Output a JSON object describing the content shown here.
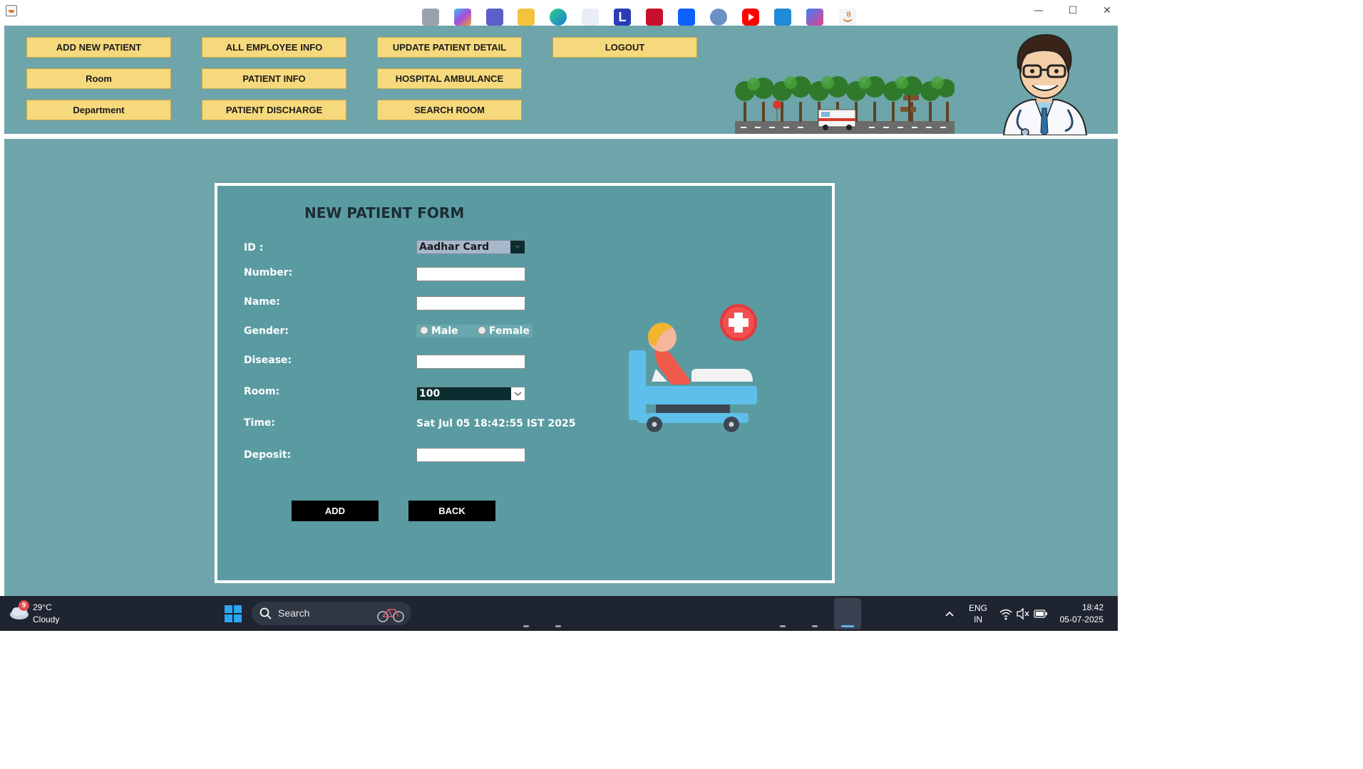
{
  "window": {
    "minimize": "—",
    "maximize": "☐",
    "close": "✕"
  },
  "nav": {
    "buttons": [
      {
        "label": "ADD NEW PATIENT"
      },
      {
        "label": "ALL EMPLOYEE INFO"
      },
      {
        "label": "UPDATE PATIENT DETAIL"
      },
      {
        "label": "LOGOUT"
      },
      {
        "label": "Room"
      },
      {
        "label": "PATIENT INFO"
      },
      {
        "label": "HOSPITAL AMBULANCE"
      },
      {
        "label": "Department"
      },
      {
        "label": "PATIENT DISCHARGE"
      },
      {
        "label": "SEARCH ROOM"
      }
    ]
  },
  "form": {
    "title": "NEW PATIENT FORM",
    "labels": {
      "id": "ID :",
      "number": "Number:",
      "name": "Name:",
      "gender": "Gender:",
      "disease": "Disease:",
      "room": "Room:",
      "time": "Time:",
      "deposit": "Deposit:"
    },
    "id_type_selected": "Aadhar Card",
    "number_value": "",
    "name_value": "",
    "gender_options": [
      "Male",
      "Female"
    ],
    "disease_value": "",
    "room_selected": "100",
    "time_value": "Sat Jul 05 18:42:55 IST 2025",
    "deposit_value": "",
    "add_label": "ADD",
    "back_label": "BACK"
  },
  "taskbar": {
    "weather_badge": "9",
    "weather_temp": "29°C",
    "weather_desc": "Cloudy",
    "search_placeholder": "Search",
    "lang_line1": "ENG",
    "lang_line2": "IN",
    "time": "18:42",
    "date": "05-07-2025",
    "apps": [
      "start-icon",
      "task-view-icon",
      "copilot-icon",
      "teams-icon",
      "file-explorer-icon",
      "edge-icon",
      "store-icon",
      "l-app-icon",
      "mcafee-icon",
      "dropbox-icon",
      "discord-icon",
      "youtube-icon",
      "vscode-icon",
      "intellij-icon",
      "java-icon"
    ]
  },
  "colors": {
    "panel": "#6ea5ab",
    "form_bg": "#5a9ba2",
    "nav_button": "#f6d97c",
    "action_button": "#000000",
    "taskbar": "#1e2430"
  }
}
